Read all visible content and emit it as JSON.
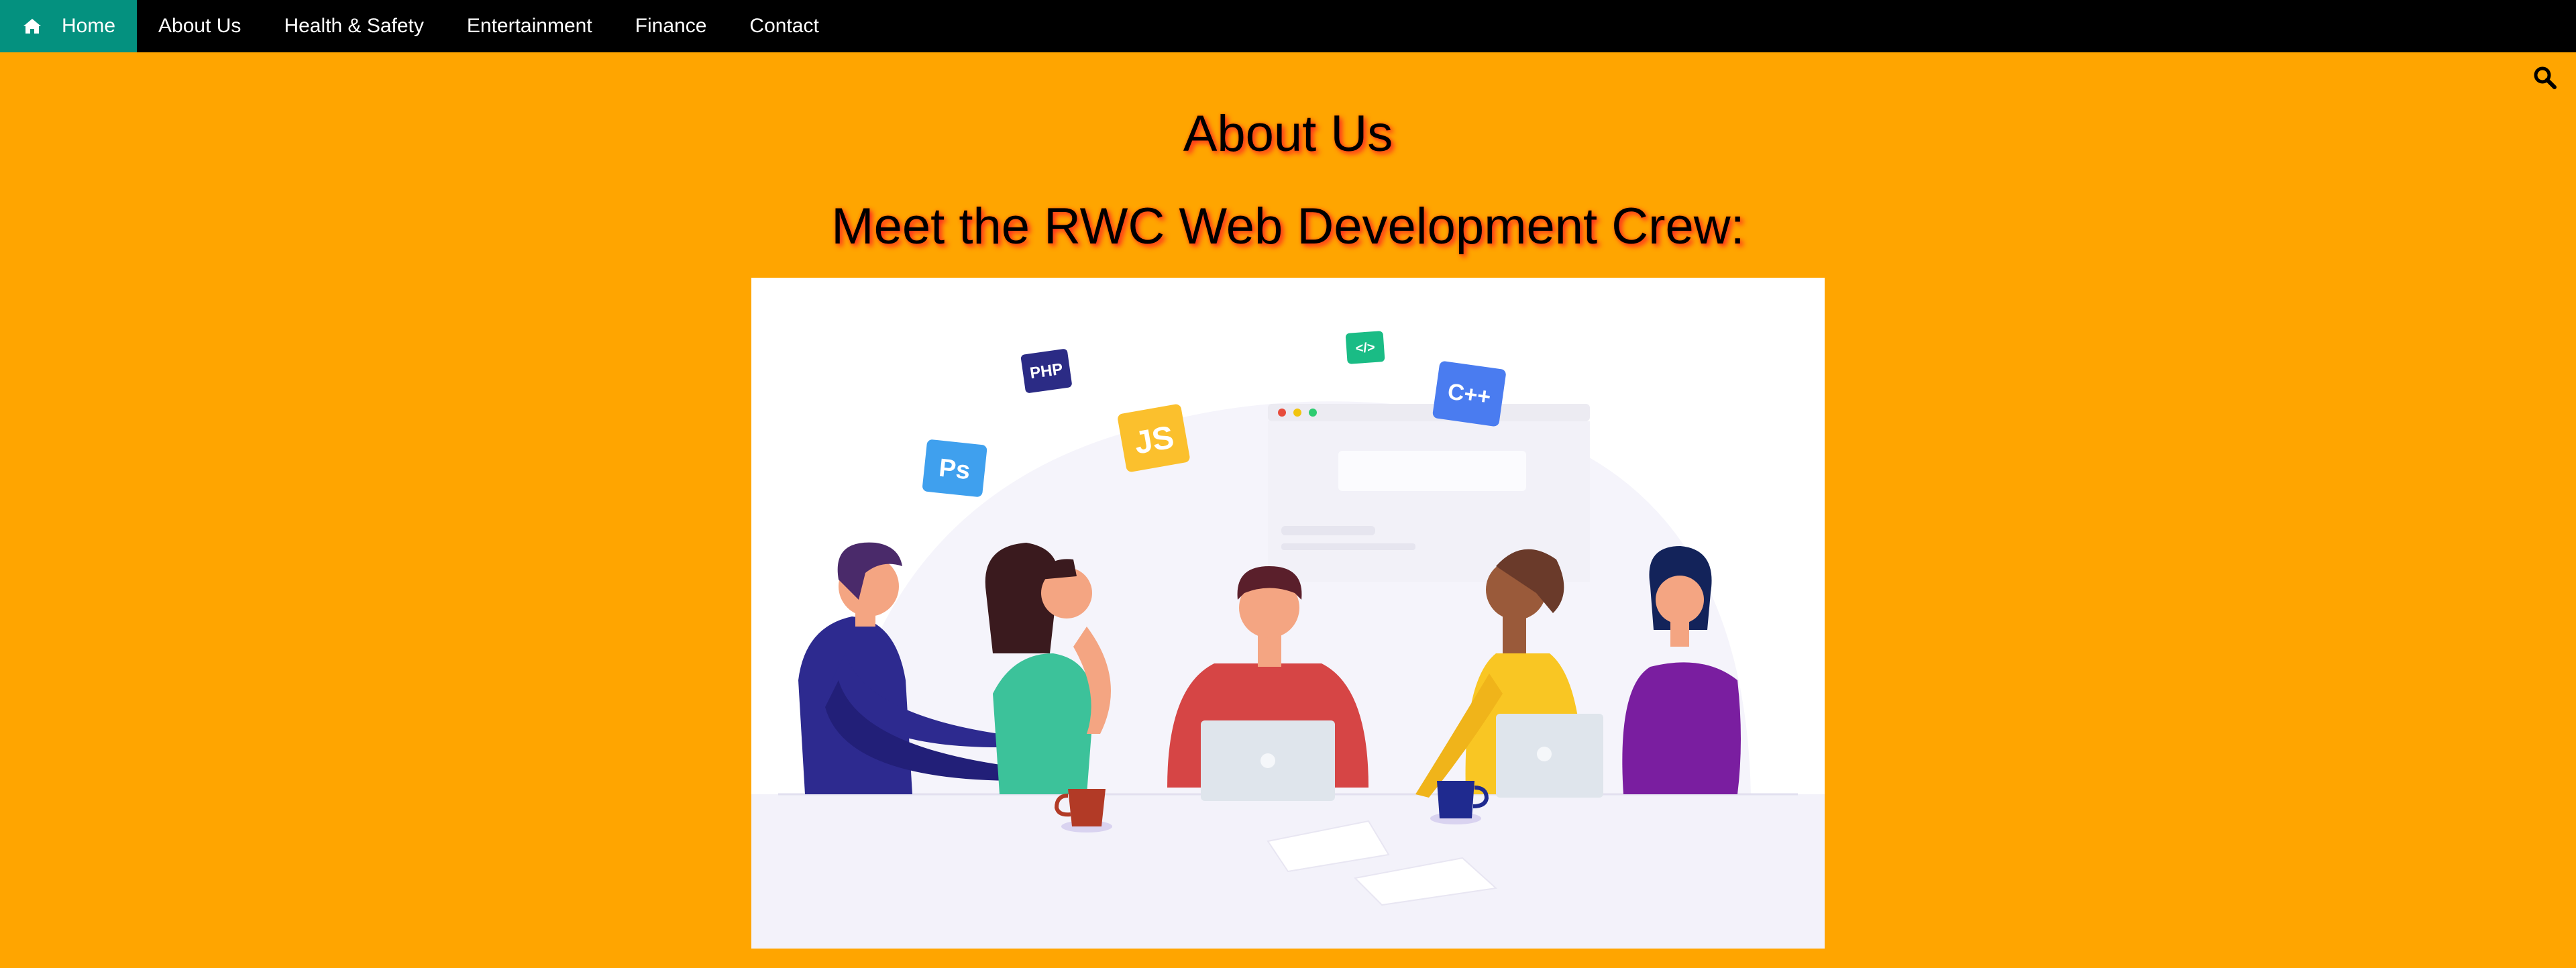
{
  "nav": {
    "items": [
      {
        "label": "Home",
        "icon": "home-icon",
        "active": true
      },
      {
        "label": "About Us",
        "active": false
      },
      {
        "label": "Health & Safety",
        "active": false
      },
      {
        "label": "Entertainment",
        "active": false
      },
      {
        "label": "Finance",
        "active": false
      },
      {
        "label": "Contact",
        "active": false
      }
    ],
    "active_color": "#04917f",
    "bar_color": "#000000"
  },
  "search": {
    "icon": "search-icon"
  },
  "page": {
    "title": "About Us",
    "subtitle": "Meet the RWC Web Development Crew:",
    "background": "#ffa500"
  },
  "illustration": {
    "badges": [
      "PHP",
      "Ps",
      "JS",
      "</>",
      "C++"
    ]
  }
}
